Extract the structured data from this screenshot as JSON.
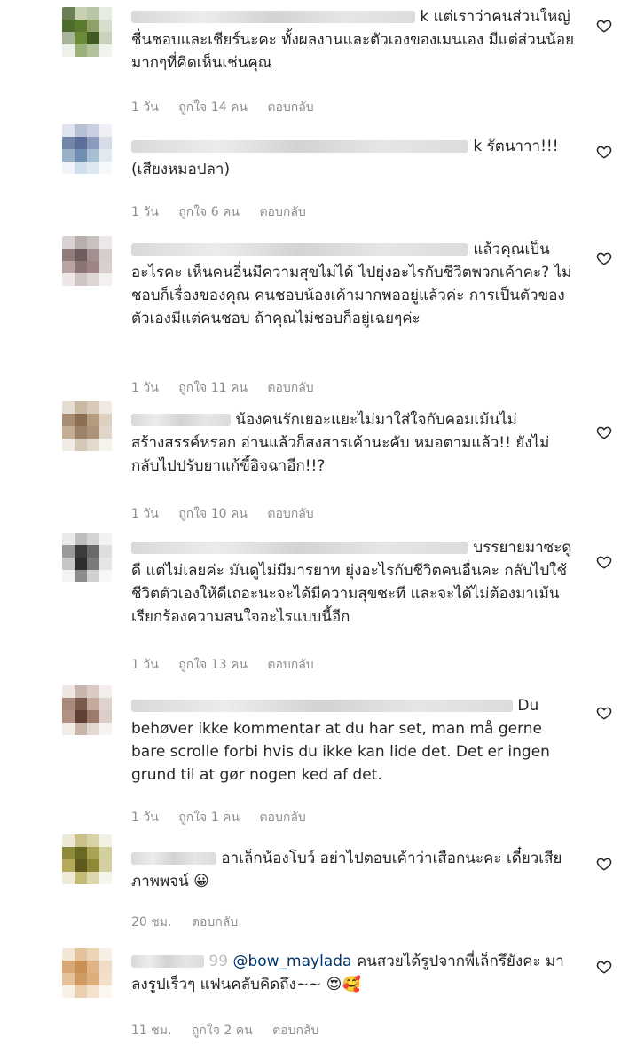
{
  "comments": [
    {
      "avatar": [
        "#6b7f54",
        "#c7d1b2",
        "#b8c5a7",
        "#e6ece0",
        "#4e6b2e",
        "#5a7a2e",
        "#8fa06a",
        "#d7dfcc",
        "#a9b59a",
        "#6b8a3a",
        "#3f5b22",
        "#c9d2bd",
        "#eef1ea",
        "#9bb07a",
        "#b4c29e",
        "#f1f3ee"
      ],
      "text_after": "k แต่เราว่าคนส่วนใหญ่ชื่นชอบและเชียร์นะคะ ทั้งผลงานและตัวเองของเมนเอง มีแต่ส่วนน้อยมากๆที่คิดเห็นเช่นคุณ",
      "time": "1 วัน",
      "likes": "ถูกใจ 14 คน",
      "reply": "ตอบกลับ"
    },
    {
      "avatar": [
        "#dfe3ee",
        "#b7c1d6",
        "#c8cfe0",
        "#eef0f5",
        "#7486a8",
        "#5a6f99",
        "#8c9bbd",
        "#d6dbe8",
        "#9ab0c6",
        "#6f8fb0",
        "#a8bfd3",
        "#e0e8f0",
        "#f0f4f8",
        "#cfe0ec",
        "#dde8f0",
        "#f5f8fb"
      ],
      "text_after": "k รัตนาาา!!! (เสียงหมอปลา)",
      "time": "1 วัน",
      "likes": "ถูกใจ 6 คน",
      "reply": "ตอบกลับ"
    },
    {
      "avatar": [
        "#d8d2d2",
        "#b9aeae",
        "#c9c0c0",
        "#ece8e8",
        "#8f7d7d",
        "#6f5c5c",
        "#a39090",
        "#d6cccc",
        "#b7a5a5",
        "#8a7474",
        "#9c8484",
        "#d9cfcf",
        "#ece6e6",
        "#cfc4c4",
        "#ddd4d4",
        "#f4f0f0"
      ],
      "text_after": "แล้วคุณเป็นอะไรคะ เห็นคนอื่นมีความสุขไม่ได้ ไปยุ่งอะไรกับชีวิตพวกเค้าคะ? ไม่ชอบก็เรื่องของคุณ คนชอบน้องเค้ามากพออยู่แล้วค่ะ การเป็นตัวของตัวเองมีแต่คนชอบ ถ้าคุณไม่ชอบก็อยู่เฉยๆค่ะ",
      "time": "1 วัน",
      "likes": "ถูกใจ 11 คน",
      "reply": "ตอบกลับ"
    },
    {
      "avatar": [
        "#e4ddd2",
        "#c9b9a3",
        "#d7cab8",
        "#efe9e0",
        "#a78e73",
        "#8c6f52",
        "#b59b80",
        "#ddd0c0",
        "#c4ad95",
        "#9c8268",
        "#ab9379",
        "#e0d5c8",
        "#f0ebe4",
        "#d6c8b7",
        "#e3d9cd",
        "#f6f2ec"
      ],
      "text_after": "น้องคนรักเยอะแยะไม่มาใส่ใจกับคอมเม้นไม่สร้างสรรค์หรอก อ่านแล้วก็สงสารเค้านะคับ หมอตามแล้ว!! ยังไม่กลับไปปรับยาแก้ขี้อิจฉาอีก!!?",
      "time": "1 วัน",
      "likes": "ถูกใจ 10 คน",
      "reply": "ตอบกลับ"
    },
    {
      "avatar": [
        "#e9e9e9",
        "#bdbdbd",
        "#d3d3d3",
        "#f2f2f2",
        "#9a9a9a",
        "#3c3c3c",
        "#6a6a6a",
        "#dedede",
        "#c6c6c6",
        "#2e2e2e",
        "#7a7a7a",
        "#e6e6e6",
        "#f3f3f3",
        "#8c8c8c",
        "#cfcfcf",
        "#f7f7f7"
      ],
      "text_after": "บรรยายมาซะดูดี แต่ไม่เลยค่ะ มันดูไม่มีมารยาท ยุ่งอะไรกับชีวิตคนอื่นคะ กลับไปใช้ชีวิตตัวเองให้ดีเถอะนะจะได้มีความสุขซะที และจะได้ไม่ต้องมาเม้นเรียกร้องความสนใจอะไรแบบนี้อีก",
      "time": "1 วัน",
      "likes": "ถูกใจ 13 คน",
      "reply": "ตอบกลับ"
    },
    {
      "avatar": [
        "#ede6e3",
        "#c7b6ae",
        "#d9cbc4",
        "#f3eeeb",
        "#a88a7d",
        "#7a5a4c",
        "#c4a99c",
        "#e0d3cd",
        "#b39283",
        "#5e4034",
        "#9c7b6c",
        "#dccdc6",
        "#f2ece9",
        "#c9b4aa",
        "#e4d8d2",
        "#f7f3f1"
      ],
      "text_after": "Du behøver ikke kommentar at du har set, man må gerne bare scrolle forbi hvis du ikke kan lide det. Det er ingen grund til at gør nogen ked af det.",
      "time": "1 วัน",
      "likes": "ถูกใจ 1 คน",
      "reply": "ตอบกลับ"
    },
    {
      "avatar": [
        "#ece9d6",
        "#c9c08a",
        "#d8d2a8",
        "#f2f0e2",
        "#8f8a3a",
        "#6b6a24",
        "#a9a453",
        "#d3cf9c",
        "#b4aa5a",
        "#5c5a1e",
        "#8e8838",
        "#d6d0a0",
        "#eeecd8",
        "#c2bb78",
        "#dcd7ad",
        "#f6f5ea"
      ],
      "text_after": "อาเล็กน้องโบว์ อย่าไปตอบเค้าว่าเสือกนะคะ เดี๋ยวเสียภาพพจน์ 😀",
      "time": "20 ชม.",
      "likes": "",
      "reply": "ตอบกลับ"
    },
    {
      "avatar": [
        "#f3e6d6",
        "#e3c39c",
        "#ebd4b6",
        "#f7efe4",
        "#d9a774",
        "#c98f55",
        "#e0b486",
        "#f0dcc4",
        "#e6c29a",
        "#cf9a62",
        "#dcae7c",
        "#f1dfca",
        "#f8f1e8",
        "#eacfae",
        "#f3e2cd",
        "#fbf6ef"
      ],
      "text_pre": "99",
      "mention": "@bow_maylada",
      "text_after": " คนสวยได้รูปจากพี่เล็กรึยังคะ มาลงรูปเร็วๆ แฟนคลับคิดถึง~~ 😍🥰",
      "time": "11 ชม.",
      "likes": "ถูกใจ 2 คน",
      "reply": "ตอบกลับ"
    }
  ]
}
